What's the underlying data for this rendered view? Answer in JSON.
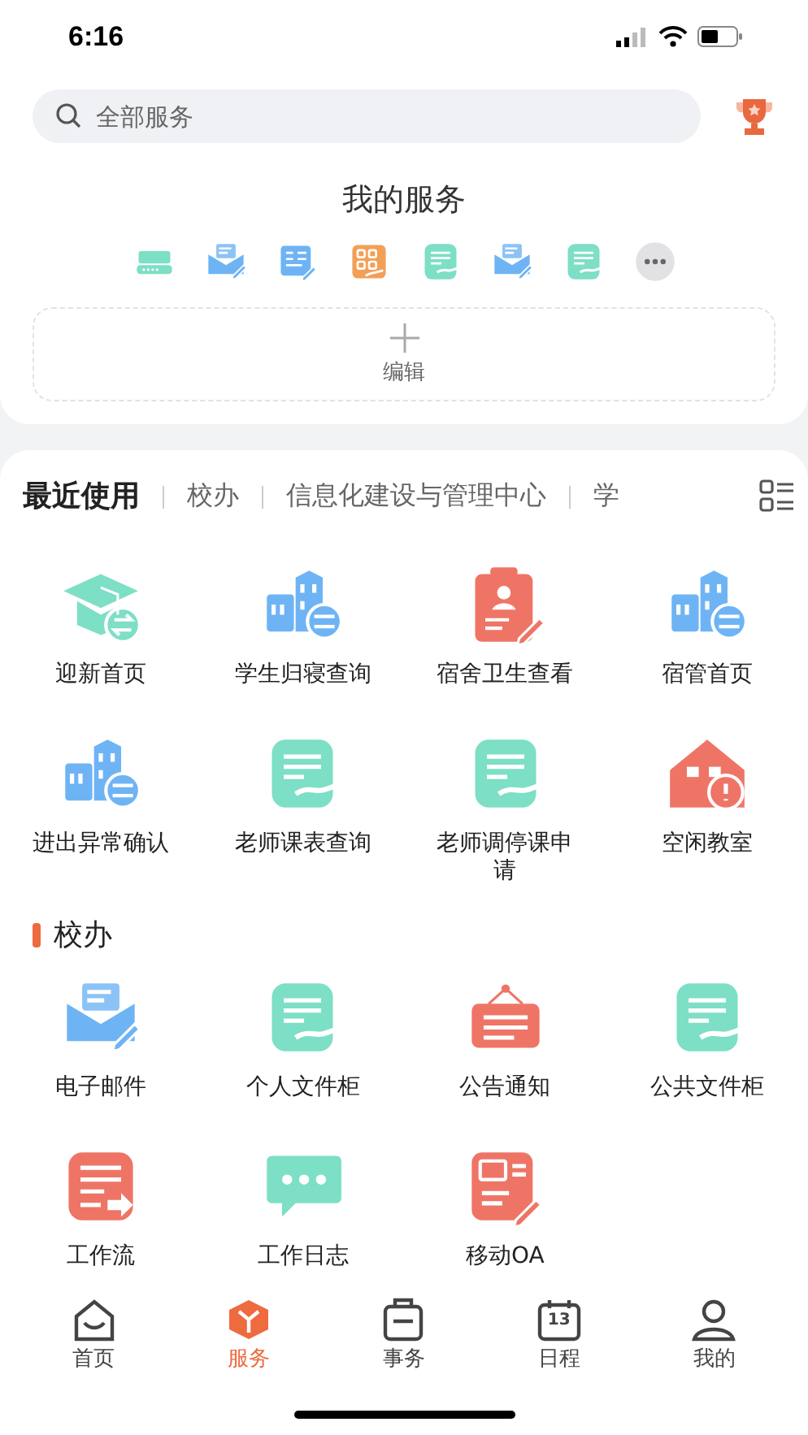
{
  "status_bar": {
    "time": "6:16"
  },
  "search": {
    "placeholder": "全部服务"
  },
  "my_services": {
    "title": "我的服务",
    "icons": [
      {
        "kind": "vpn"
      },
      {
        "kind": "mail"
      },
      {
        "kind": "form"
      },
      {
        "kind": "apps"
      },
      {
        "kind": "doc-hand"
      },
      {
        "kind": "mail"
      },
      {
        "kind": "doc-hand"
      },
      {
        "kind": "more"
      }
    ],
    "edit_label": "编辑"
  },
  "tabs": [
    {
      "label": "最近使用",
      "selected": true
    },
    {
      "label": "校办",
      "selected": false
    },
    {
      "label": "信息化建设与管理中心",
      "selected": false
    },
    {
      "label": "学",
      "selected": false
    }
  ],
  "recent": [
    {
      "label": "迎新首页",
      "kind": "grad-cap"
    },
    {
      "label": "学生归寝查询",
      "kind": "buildings"
    },
    {
      "label": "宿舍卫生查看",
      "kind": "clipboard"
    },
    {
      "label": "宿管首页",
      "kind": "buildings"
    },
    {
      "label": "进出异常确认",
      "kind": "buildings"
    },
    {
      "label": "老师课表查询",
      "kind": "doc-hand"
    },
    {
      "label": "老师调停课申请",
      "kind": "doc-hand"
    },
    {
      "label": "空闲教室",
      "kind": "house"
    }
  ],
  "section": {
    "title": "校办",
    "items": [
      {
        "label": "电子邮件",
        "kind": "mail"
      },
      {
        "label": "个人文件柜",
        "kind": "doc-hand"
      },
      {
        "label": "公告通知",
        "kind": "notice"
      },
      {
        "label": "公共文件柜",
        "kind": "doc-hand"
      },
      {
        "label": "工作流",
        "kind": "workflow"
      },
      {
        "label": "工作日志",
        "kind": "chat"
      },
      {
        "label": "移动OA",
        "kind": "oa"
      }
    ]
  },
  "bottom_nav": [
    {
      "label": "首页",
      "kind": "home",
      "selected": false
    },
    {
      "label": "服务",
      "kind": "service",
      "selected": true
    },
    {
      "label": "事务",
      "kind": "tasks",
      "selected": false
    },
    {
      "label": "日程",
      "kind": "calendar",
      "selected": false,
      "day": "13"
    },
    {
      "label": "我的",
      "kind": "profile",
      "selected": false
    }
  ]
}
